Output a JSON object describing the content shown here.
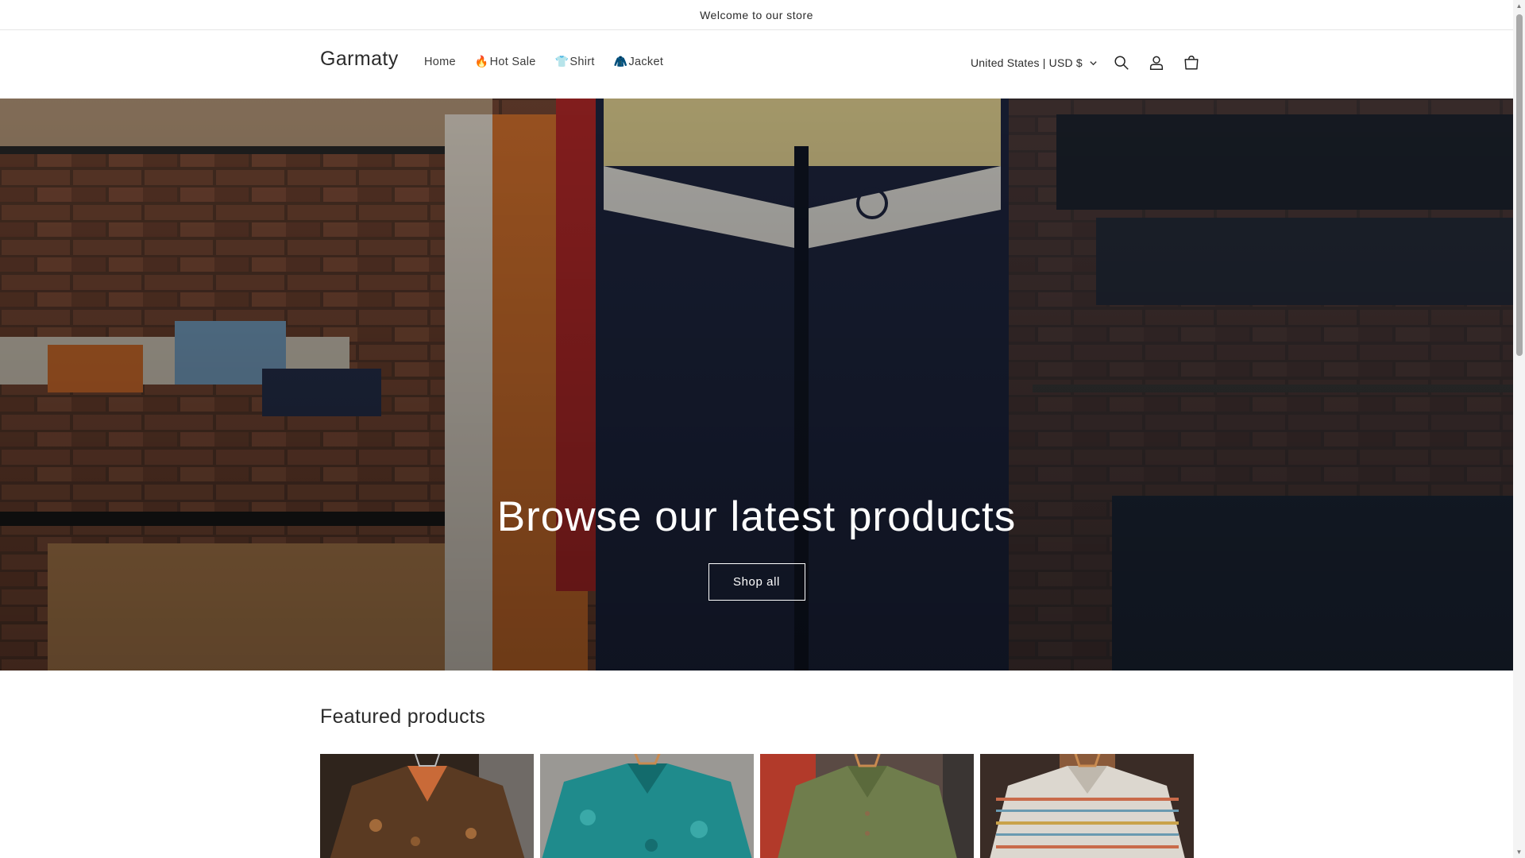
{
  "announcement": {
    "text": "Welcome to our store"
  },
  "header": {
    "brand": "Garmaty",
    "nav": [
      {
        "emoji": "",
        "label": "Home"
      },
      {
        "emoji": "🔥",
        "label": "Hot Sale"
      },
      {
        "emoji": "👕",
        "label": "Shirt"
      },
      {
        "emoji": "🧥",
        "label": "Jacket"
      }
    ],
    "country_selector": "United States | USD $",
    "icons": [
      "search-icon",
      "account-icon",
      "cart-icon"
    ]
  },
  "hero": {
    "title": "Browse our latest products",
    "button_label": "Shop all"
  },
  "featured": {
    "title": "Featured products",
    "products": [
      {
        "image": "paisley-brown-shirt"
      },
      {
        "image": "teal-floral-shirt"
      },
      {
        "image": "olive-green-shirt"
      },
      {
        "image": "striped-pattern-shirt"
      }
    ]
  },
  "colors": {
    "text": "#121212",
    "hero_overlay": "#000000",
    "border": "#e6e6e6"
  }
}
